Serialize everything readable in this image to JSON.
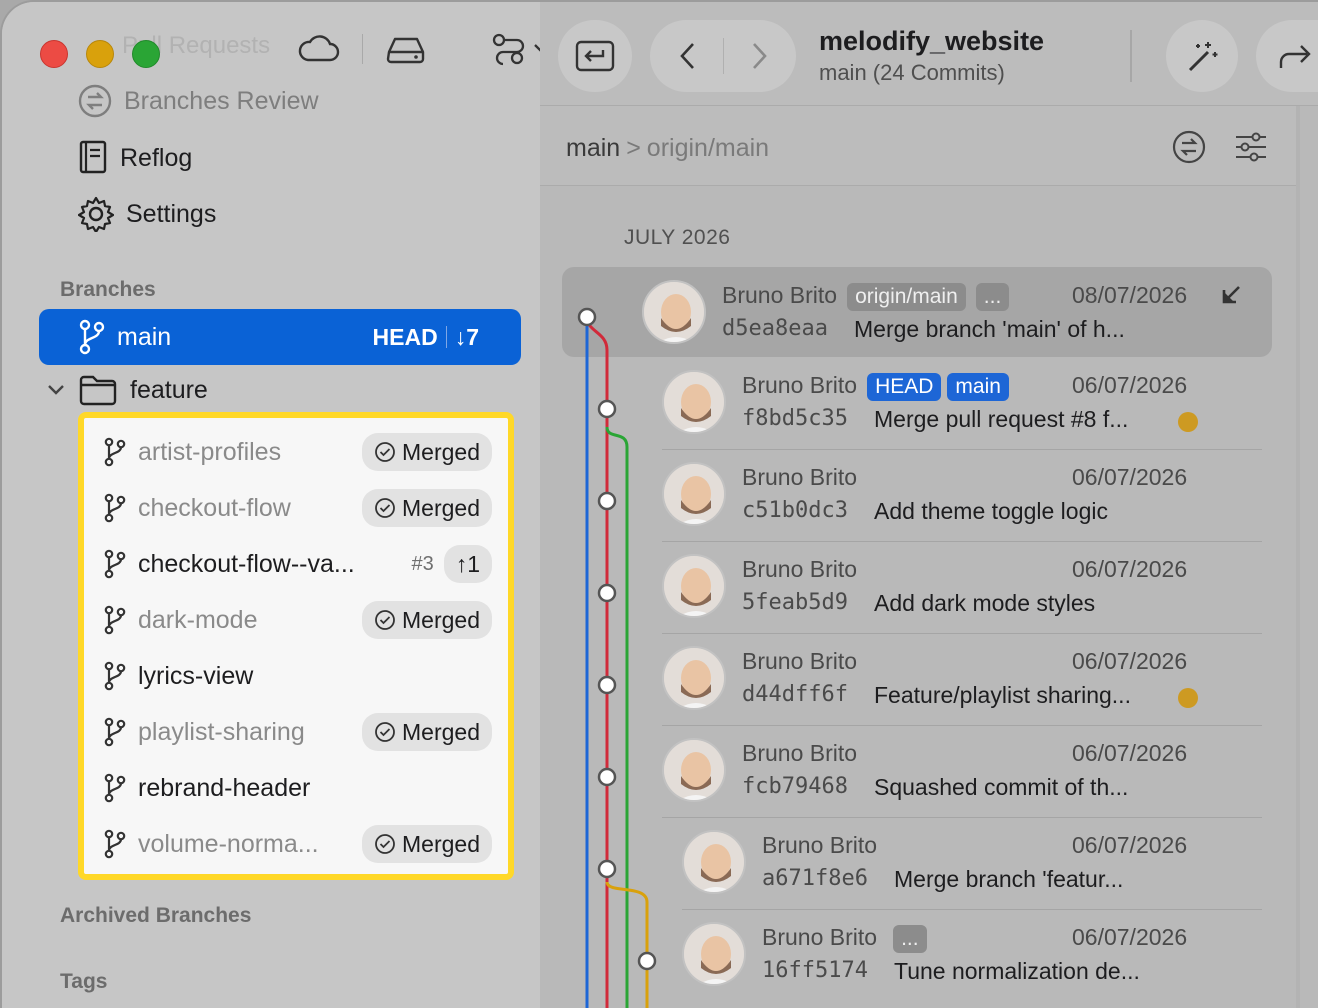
{
  "sidebar": {
    "ghost_title": "Pull Requests",
    "nav": {
      "branches_review": "Branches Review",
      "reflog": "Reflog",
      "settings": "Settings"
    },
    "sections": {
      "branches": "Branches",
      "archived": "Archived Branches",
      "tags": "Tags"
    },
    "main_branch": {
      "name": "main",
      "head": "HEAD",
      "behind": "↓7"
    },
    "folder": "feature",
    "feature_branches": [
      {
        "name": "artist-profiles",
        "badge": "Merged"
      },
      {
        "name": "checkout-flow",
        "badge": "Merged"
      },
      {
        "name": "checkout-flow--va...",
        "pr": "#3",
        "badge": "↑1"
      },
      {
        "name": "dark-mode",
        "badge": "Merged"
      },
      {
        "name": "lyrics-view",
        "badge": ""
      },
      {
        "name": "playlist-sharing",
        "badge": "Merged"
      },
      {
        "name": "rebrand-header",
        "badge": ""
      },
      {
        "name": "volume-norma...",
        "badge": "Merged"
      }
    ]
  },
  "toolbar": {
    "repo": "melodify_website",
    "subtitle": "main (24 Commits)"
  },
  "breadcrumb": {
    "current": "main",
    "separator": ">",
    "upstream": "origin/main"
  },
  "history": {
    "month": "JULY 2026",
    "commits": [
      {
        "author": "Bruno Brito",
        "tags": [
          "origin/main",
          "..."
        ],
        "date": "08/07/2026",
        "sha": "d5ea8eaa",
        "msg": "Merge branch 'main' of h..."
      },
      {
        "author": "Bruno Brito",
        "tags": [
          "HEAD",
          "main"
        ],
        "date": "06/07/2026",
        "sha": "f8bd5c35",
        "msg": "Merge pull request #8 f..."
      },
      {
        "author": "Bruno Brito",
        "tags": [],
        "date": "06/07/2026",
        "sha": "c51b0dc3",
        "msg": "Add theme toggle logic"
      },
      {
        "author": "Bruno Brito",
        "tags": [],
        "date": "06/07/2026",
        "sha": "5feab5d9",
        "msg": "Add dark mode styles"
      },
      {
        "author": "Bruno Brito",
        "tags": [],
        "date": "06/07/2026",
        "sha": "d44dff6f",
        "msg": "Feature/playlist sharing..."
      },
      {
        "author": "Bruno Brito",
        "tags": [],
        "date": "06/07/2026",
        "sha": "fcb79468",
        "msg": "Squashed commit of th..."
      },
      {
        "author": "Bruno Brito",
        "tags": [],
        "date": "06/07/2026",
        "sha": "a671f8e6",
        "msg": "Merge branch 'featur..."
      },
      {
        "author": "Bruno Brito",
        "tags": [
          "..."
        ],
        "date": "06/07/2026",
        "sha": "16ff5174",
        "msg": "Tune normalization de..."
      }
    ]
  },
  "colors": {
    "accent": "#0a62d6",
    "highlight": "#ffd828",
    "lane_blue": "#1d66d6",
    "lane_red": "#d12a3a",
    "lane_green": "#2aa535",
    "lane_yellow": "#d9a10c"
  }
}
